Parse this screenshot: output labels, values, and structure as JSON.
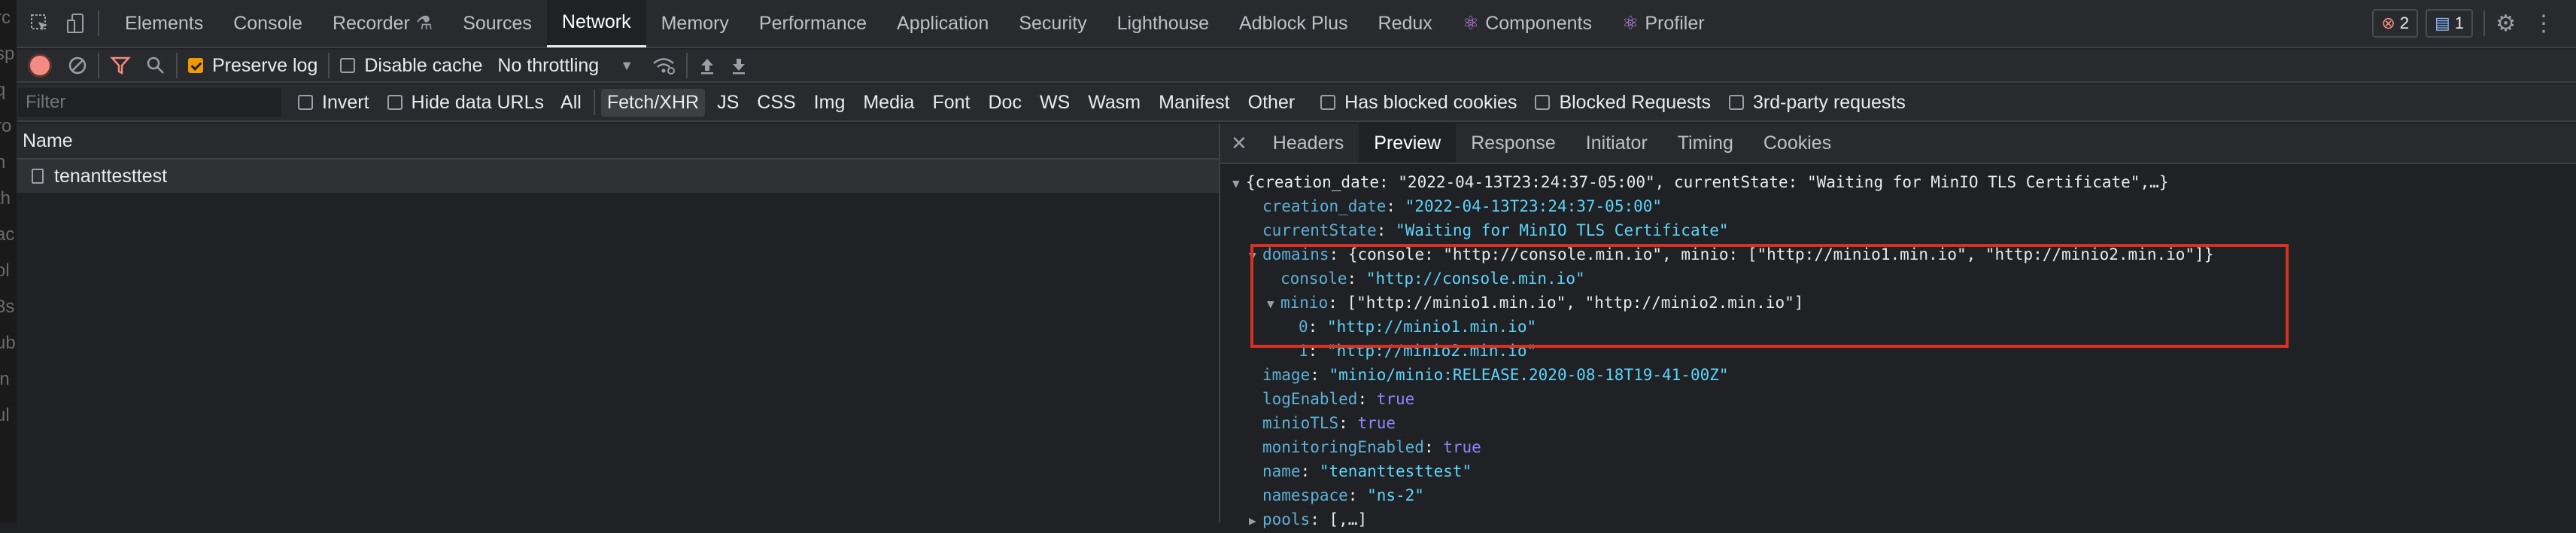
{
  "tabs": {
    "items": [
      "Elements",
      "Console",
      "Recorder",
      "Sources",
      "Network",
      "Memory",
      "Performance",
      "Application",
      "Security",
      "Lighthouse",
      "Adblock Plus",
      "Redux",
      "Components",
      "Profiler"
    ],
    "active": "Network",
    "errors_count": "2",
    "messages_count": "1"
  },
  "toolbar": {
    "preserve_log": "Preserve log",
    "disable_cache": "Disable cache",
    "throttling": "No throttling"
  },
  "filterbar": {
    "placeholder": "Filter",
    "invert": "Invert",
    "hide_data_urls": "Hide data URLs",
    "types": [
      "All",
      "Fetch/XHR",
      "JS",
      "CSS",
      "Img",
      "Media",
      "Font",
      "Doc",
      "WS",
      "Wasm",
      "Manifest",
      "Other"
    ],
    "active_type": "Fetch/XHR",
    "has_blocked_cookies": "Has blocked cookies",
    "blocked_requests": "Blocked Requests",
    "third_party": "3rd-party requests"
  },
  "requests": {
    "column_name": "Name",
    "rows": [
      "tenanttesttest"
    ]
  },
  "detail_tabs": {
    "items": [
      "Headers",
      "Preview",
      "Response",
      "Initiator",
      "Timing",
      "Cookies"
    ],
    "active": "Preview"
  },
  "preview": {
    "summary": "{creation_date: \"2022-04-13T23:24:37-05:00\", currentState: \"Waiting for MinIO TLS Certificate\",…}",
    "creation_date_key": "creation_date",
    "creation_date_val": "\"2022-04-13T23:24:37-05:00\"",
    "current_state_key": "currentState",
    "current_state_val": "\"Waiting for MinIO TLS Certificate\"",
    "domains_key": "domains",
    "domains_summary": "{console: \"http://console.min.io\", minio: [\"http://minio1.min.io\", \"http://minio2.min.io\"]}",
    "console_key": "console",
    "console_val": "\"http://console.min.io\"",
    "minio_key": "minio",
    "minio_summary": "[\"http://minio1.min.io\", \"http://minio2.min.io\"]",
    "minio_0_key": "0",
    "minio_0_val": "\"http://minio1.min.io\"",
    "minio_1_key": "1",
    "minio_1_val": "\"http://minio2.min.io\"",
    "image_key": "image",
    "image_val": "\"minio/minio:RELEASE.2020-08-18T19-41-00Z\"",
    "log_enabled_key": "logEnabled",
    "log_enabled_val": "true",
    "minio_tls_key": "minioTLS",
    "minio_tls_val": "true",
    "monitoring_key": "monitoringEnabled",
    "monitoring_val": "true",
    "name_key": "name",
    "name_val": "\"tenanttesttest\"",
    "namespace_key": "namespace",
    "namespace_val": "\"ns-2\"",
    "pools_key": "pools",
    "pools_val": "[,…]"
  },
  "colors": {
    "highlight_box": "#d93025",
    "record": "#f28b82",
    "accent": "#f29900"
  }
}
